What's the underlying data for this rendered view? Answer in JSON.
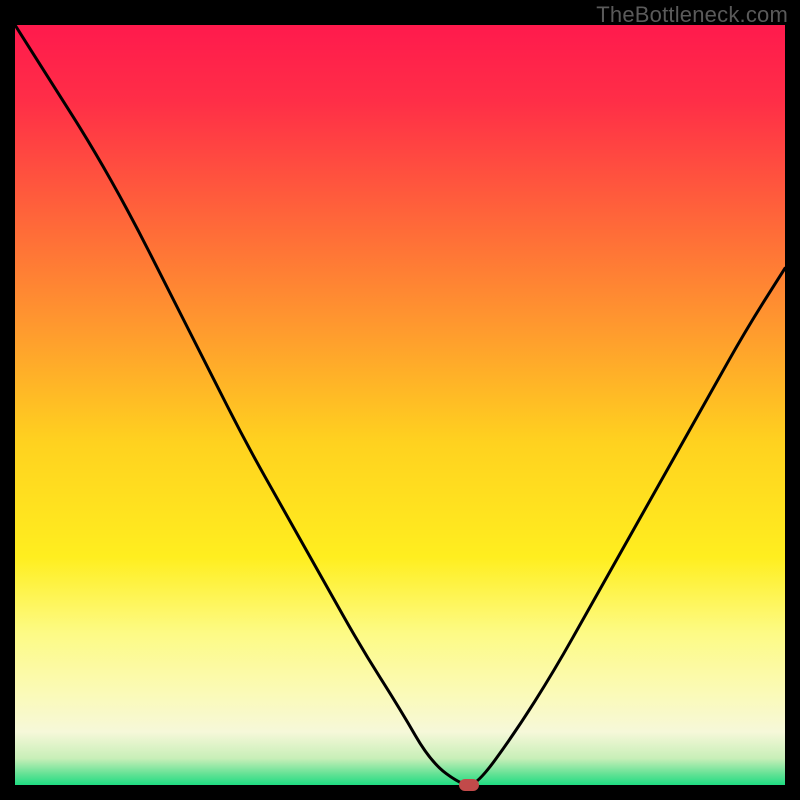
{
  "watermark": "TheBottleneck.com",
  "colors": {
    "gradient_stops": [
      {
        "offset": 0.0,
        "color": "#ff1a4d"
      },
      {
        "offset": 0.1,
        "color": "#ff2e47"
      },
      {
        "offset": 0.25,
        "color": "#ff643a"
      },
      {
        "offset": 0.4,
        "color": "#ff9a2e"
      },
      {
        "offset": 0.55,
        "color": "#ffd21f"
      },
      {
        "offset": 0.7,
        "color": "#ffee1f"
      },
      {
        "offset": 0.8,
        "color": "#fdfb85"
      },
      {
        "offset": 0.88,
        "color": "#fbfab8"
      },
      {
        "offset": 0.93,
        "color": "#f6f8d9"
      },
      {
        "offset": 0.965,
        "color": "#c8efb8"
      },
      {
        "offset": 0.985,
        "color": "#66e296"
      },
      {
        "offset": 1.0,
        "color": "#1fdc82"
      }
    ],
    "curve": "#000000",
    "marker": "#c24a4a",
    "background": "#000000"
  },
  "chart_data": {
    "type": "line",
    "x": [
      0.0,
      0.05,
      0.1,
      0.15,
      0.2,
      0.25,
      0.3,
      0.35,
      0.4,
      0.45,
      0.5,
      0.54,
      0.58,
      0.6,
      0.65,
      0.7,
      0.75,
      0.8,
      0.85,
      0.9,
      0.95,
      1.0
    ],
    "values": [
      100,
      92,
      84,
      75,
      65,
      55,
      45,
      36,
      27,
      18,
      10,
      3,
      0,
      0,
      7,
      15,
      24,
      33,
      42,
      51,
      60,
      68
    ],
    "title": "",
    "xlabel": "",
    "ylabel": "",
    "xlim": [
      0,
      1
    ],
    "ylim": [
      0,
      100
    ],
    "marker": {
      "x": 0.59,
      "y": 0
    },
    "notes": "x is normalized horizontal position across the plot area; values are bottleneck percentage (0 = optimal match, 100 = maximum bottleneck). Curve reaches 0 and flattens briefly around x≈0.56–0.60 then rises again."
  }
}
